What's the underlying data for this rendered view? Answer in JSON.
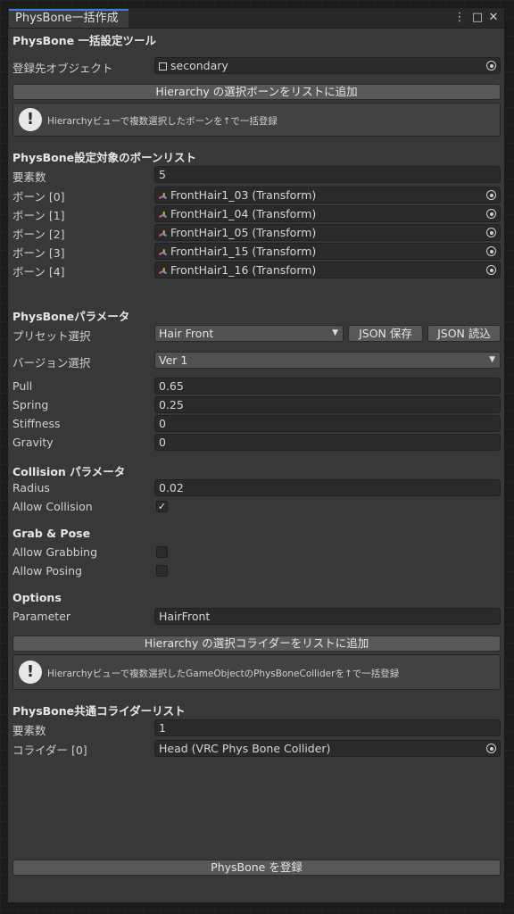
{
  "window": {
    "tab_title": "PhysBone一括作成"
  },
  "tool": {
    "title": "PhysBone 一括設定ツール",
    "target_label": "登録先オブジェクト",
    "target_value": "secondary",
    "add_bones_button": "Hierarchy の選択ボーンをリストに追加",
    "bones_help": "Hierarchyビューで複数選択したボーンを↑で一括登録",
    "bone_list_header": "PhysBone設定対象のボーンリスト",
    "bone_count_label": "要素数",
    "bone_count_value": "5",
    "bones": [
      {
        "label": "ボーン [0]",
        "value": "FrontHair1_03 (Transform)"
      },
      {
        "label": "ボーン [1]",
        "value": "FrontHair1_04 (Transform)"
      },
      {
        "label": "ボーン [2]",
        "value": "FrontHair1_05 (Transform)"
      },
      {
        "label": "ボーン [3]",
        "value": "FrontHair1_15 (Transform)"
      },
      {
        "label": "ボーン [4]",
        "value": "FrontHair1_16 (Transform)"
      }
    ],
    "params_header": "PhysBoneパラメータ",
    "preset_label": "プリセット選択",
    "preset_value": "Hair Front",
    "json_save": "JSON 保存",
    "json_load": "JSON 読込",
    "version_label": "バージョン選択",
    "version_value": "Ver 1",
    "pull_label": "Pull",
    "pull_value": "0.65",
    "spring_label": "Spring",
    "spring_value": "0.25",
    "stiffness_label": "Stiffness",
    "stiffness_value": "0",
    "gravity_label": "Gravity",
    "gravity_value": "0",
    "collision_header": "Collision パラメータ",
    "radius_label": "Radius",
    "radius_value": "0.02",
    "allow_collision_label": "Allow Collision",
    "allow_collision_checked": true,
    "grab_header": "Grab & Pose",
    "allow_grabbing_label": "Allow Grabbing",
    "allow_grabbing_checked": false,
    "allow_posing_label": "Allow Posing",
    "allow_posing_checked": false,
    "options_header": "Options",
    "parameter_label": "Parameter",
    "parameter_value": "HairFront",
    "add_colliders_button": "Hierarchy の選択コライダーをリストに追加",
    "colliders_help": "Hierarchyビューで複数選択したGameObjectのPhysBoneColliderを↑で一括登録",
    "collider_list_header": "PhysBone共通コライダーリスト",
    "collider_count_label": "要素数",
    "collider_count_value": "1",
    "colliders": [
      {
        "label": "コライダー [0]",
        "value": "Head (VRC Phys Bone Collider)"
      }
    ],
    "register_button": "PhysBone を登録",
    "checkmark": "✓"
  },
  "icons": {
    "kebab": "⋮",
    "maximize": "□",
    "close": "✕",
    "help": "!",
    "caret": "▼"
  }
}
